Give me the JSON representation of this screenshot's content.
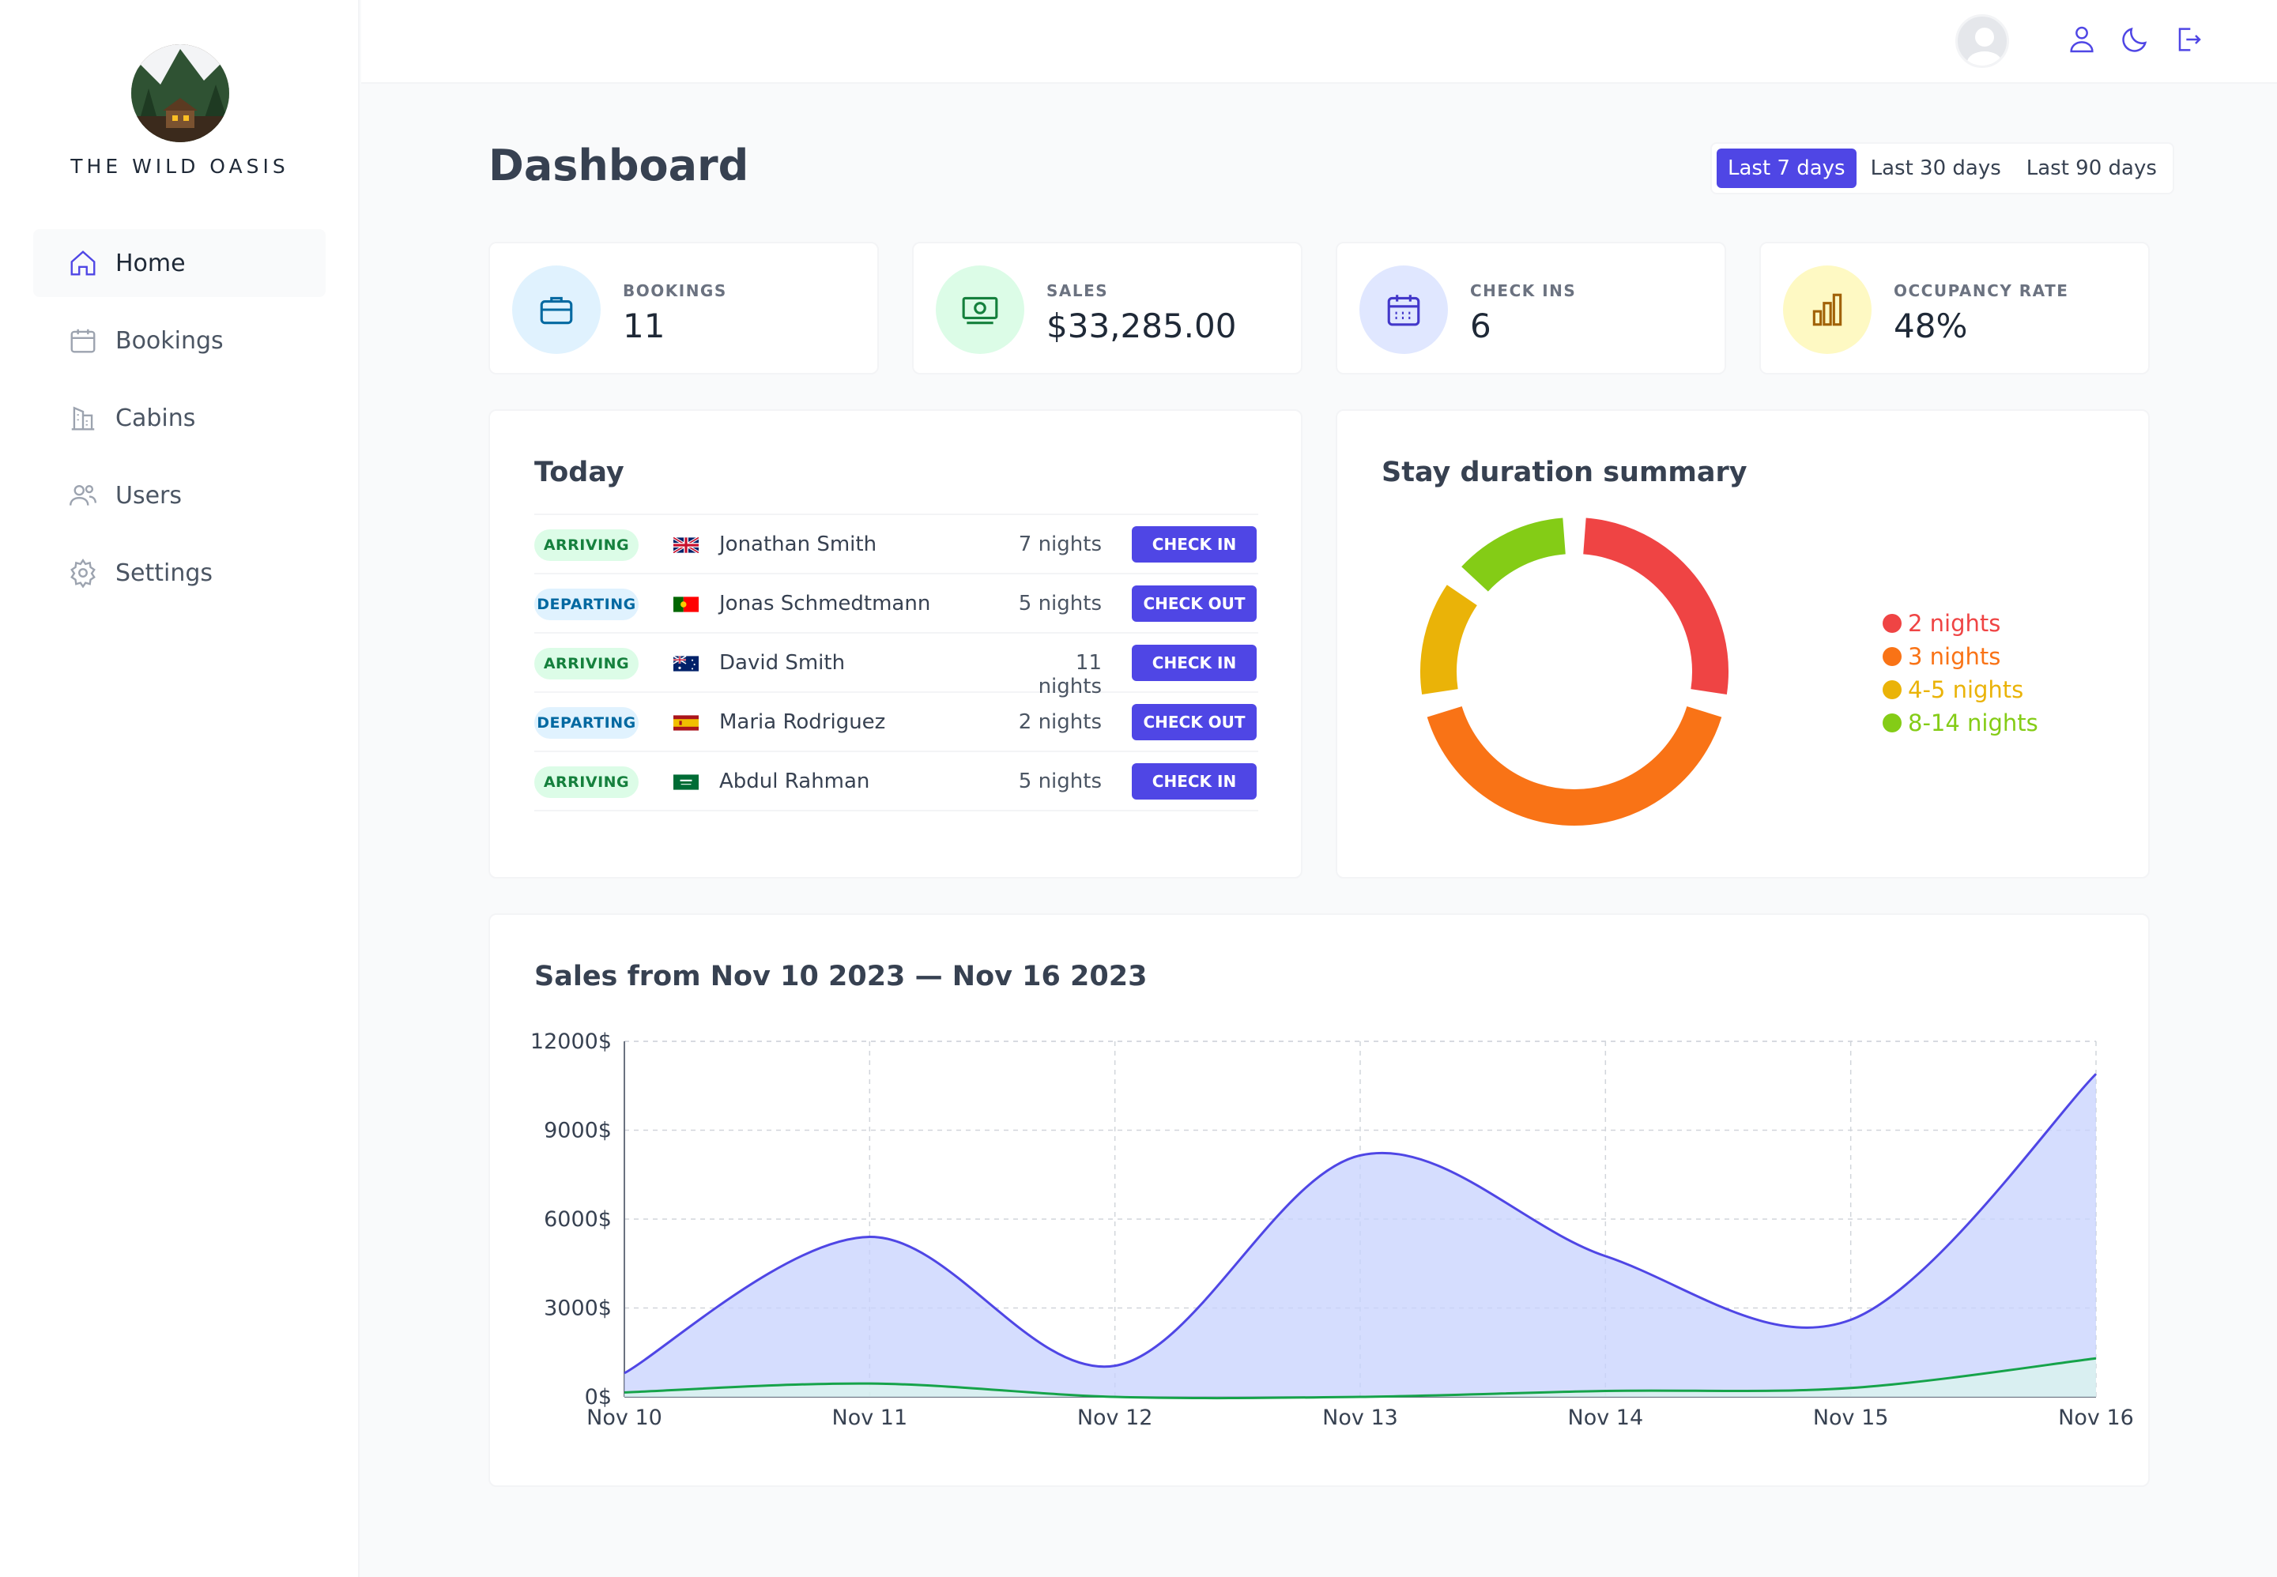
{
  "app": {
    "brand": "THE WILD OASIS"
  },
  "sidebar": {
    "items": [
      {
        "label": "Home",
        "icon": "home-icon",
        "active": true
      },
      {
        "label": "Bookings",
        "icon": "calendar-icon",
        "active": false
      },
      {
        "label": "Cabins",
        "icon": "building-icon",
        "active": false
      },
      {
        "label": "Users",
        "icon": "users-icon",
        "active": false
      },
      {
        "label": "Settings",
        "icon": "gear-icon",
        "active": false
      }
    ]
  },
  "header": {
    "icons": [
      "user-icon",
      "moon-icon",
      "logout-icon"
    ]
  },
  "page": {
    "title": "Dashboard"
  },
  "filter": {
    "options": [
      "Last 7 days",
      "Last 30 days",
      "Last 90 days"
    ],
    "selected": "Last 7 days"
  },
  "stats": [
    {
      "label": "BOOKINGS",
      "value": "11",
      "icon": "briefcase-icon",
      "color": "#0369a1",
      "bg": "#e0f2fe"
    },
    {
      "label": "SALES",
      "value": "$33,285.00",
      "icon": "banknotes-icon",
      "color": "#15803d",
      "bg": "#dcfce7"
    },
    {
      "label": "CHECK INS",
      "value": "6",
      "icon": "calendar-days-icon",
      "color": "#4338ca",
      "bg": "#e0e7ff"
    },
    {
      "label": "OCCUPANCY RATE",
      "value": "48%",
      "icon": "chart-bar-icon",
      "color": "#a16207",
      "bg": "#fef9c3"
    }
  ],
  "today": {
    "title": "Today",
    "rows": [
      {
        "status": "ARRIVING",
        "flag": "uk",
        "guest": "Jonathan Smith",
        "nights": "7 nights",
        "action": "CHECK IN"
      },
      {
        "status": "DEPARTING",
        "flag": "portugal",
        "guest": "Jonas Schmedtmann",
        "nights": "5 nights",
        "action": "CHECK OUT"
      },
      {
        "status": "ARRIVING",
        "flag": "australia",
        "guest": "David Smith",
        "nights": "11 nights",
        "action": "CHECK IN"
      },
      {
        "status": "DEPARTING",
        "flag": "spain",
        "guest": "Maria Rodriguez",
        "nights": "2 nights",
        "action": "CHECK OUT"
      },
      {
        "status": "ARRIVING",
        "flag": "saudi-arabia",
        "guest": "Abdul Rahman",
        "nights": "5 nights",
        "action": "CHECK IN"
      }
    ]
  },
  "duration": {
    "title": "Stay duration summary",
    "slices": [
      {
        "label": "2 nights",
        "value": 2,
        "color": "#ef4444"
      },
      {
        "label": "3 nights",
        "value": 3,
        "color": "#f97316"
      },
      {
        "label": "4-5 nights",
        "value": 1,
        "color": "#eab308"
      },
      {
        "label": "8-14 nights",
        "value": 1,
        "color": "#84cc16"
      }
    ]
  },
  "chart_data": {
    "type": "area",
    "title": "Sales from Nov 10 2023 — Nov 16 2023",
    "categories": [
      "Nov 10",
      "Nov 11",
      "Nov 12",
      "Nov 13",
      "Nov 14",
      "Nov 15",
      "Nov 16"
    ],
    "series": [
      {
        "values": [
          800,
          5400,
          1050,
          8150,
          4750,
          2600,
          10900
        ],
        "color": "#4f46e5",
        "fill": "#c7d2fe"
      },
      {
        "values": [
          150,
          450,
          0,
          0,
          200,
          300,
          1300
        ],
        "color": "#16a34a",
        "fill": "#dcfce7"
      }
    ],
    "yticks": [
      "0$",
      "3000$",
      "6000$",
      "9000$",
      "12000$"
    ],
    "ylim": [
      0,
      12000
    ],
    "grid": true
  }
}
